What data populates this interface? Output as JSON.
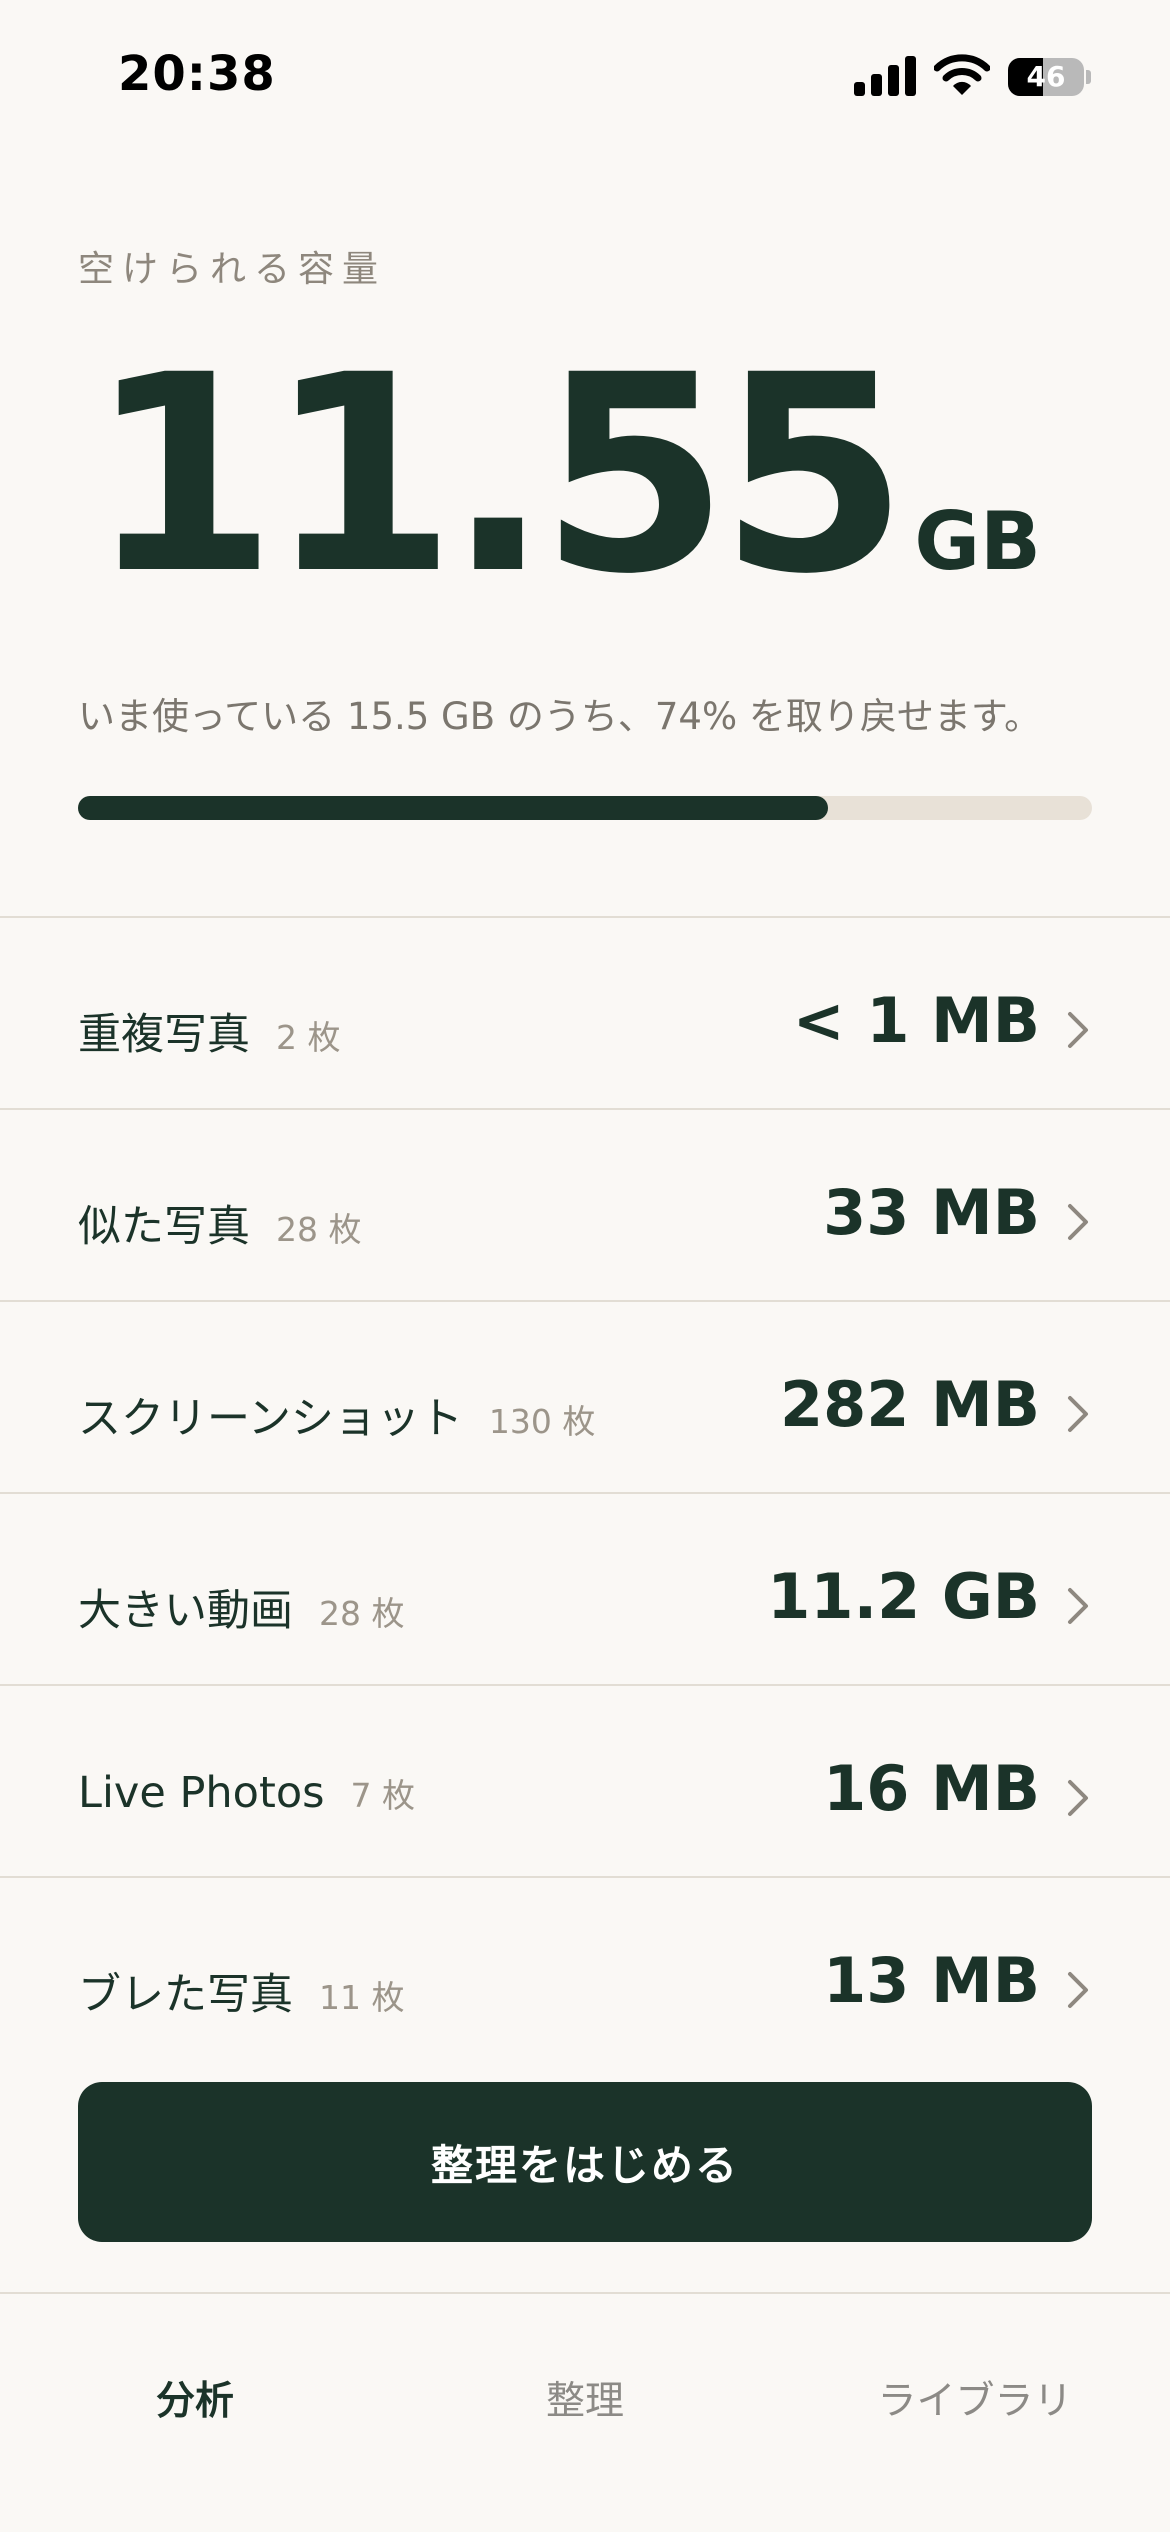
{
  "status_bar": {
    "time": "20:38",
    "battery_level": "46",
    "battery_fraction": 0.46
  },
  "summary": {
    "label": "空けられる容量",
    "value": "11.55",
    "unit": "GB",
    "description": "いま使っている 15.5 GB のうち、74% を取り戻せます。",
    "reclaimable_fraction": 0.74
  },
  "categories": [
    {
      "name": "重複写真",
      "count": "2 枚",
      "size": "< 1 MB"
    },
    {
      "name": "似た写真",
      "count": "28 枚",
      "size": "33 MB"
    },
    {
      "name": "スクリーンショット",
      "count": "130 枚",
      "size": "282 MB"
    },
    {
      "name": "大きい動画",
      "count": "28 枚",
      "size": "11.2 GB"
    },
    {
      "name": "Live Photos",
      "count": "7 枚",
      "size": "16 MB"
    },
    {
      "name": "ブレた写真",
      "count": "11 枚",
      "size": "13 MB"
    }
  ],
  "start_button": {
    "label": "整理をはじめる"
  },
  "tabs": [
    {
      "label": "分析",
      "active": true
    },
    {
      "label": "整理",
      "active": false
    },
    {
      "label": "ライブラリ",
      "active": false
    }
  ],
  "colors": {
    "background": "#faf8f5",
    "primary": "#1b3329",
    "progress_track": "#e8e1d7",
    "muted_text": "#7b766e",
    "divider": "#e2ddd4"
  },
  "icons": {
    "signal": "signal-bars-icon",
    "wifi": "wifi-icon",
    "battery": "battery-icon",
    "row_chevron": "chevron-right-icon"
  }
}
